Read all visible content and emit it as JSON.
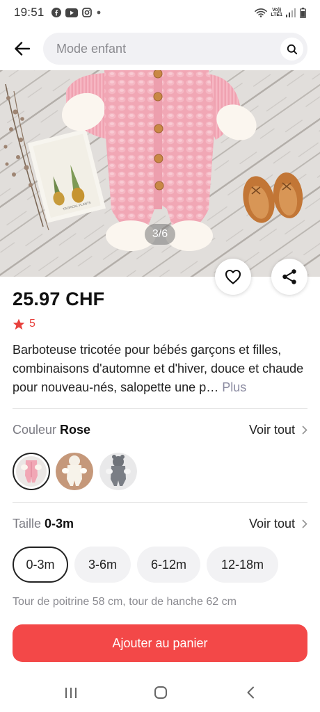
{
  "status_bar": {
    "time": "19:51",
    "network_label_top": "Vo))",
    "network_label_bottom": "LTE1"
  },
  "search": {
    "placeholder": "Mode enfant"
  },
  "product": {
    "image_pager": "3/6",
    "price": "25.97 CHF",
    "rating": "5",
    "description": "Barboteuse tricotée pour bébés garçons et filles, combinaisons d'automne et d'hiver, douce et chaude pour nouveau-nés, salopette une p…",
    "description_more": "Plus"
  },
  "color_section": {
    "label": "Couleur",
    "value": "Rose",
    "see_all": "Voir tout",
    "swatches": [
      {
        "color": "pink",
        "selected": true
      },
      {
        "color": "white",
        "selected": false
      },
      {
        "color": "gray",
        "selected": false
      }
    ]
  },
  "size_section": {
    "label": "Taille",
    "value": "0-3m",
    "see_all": "Voir tout",
    "options": [
      "0-3m",
      "3-6m",
      "6-12m",
      "12-18m"
    ],
    "selected": "0-3m",
    "note": "Tour de poitrine 58 cm, tour de hanche 62 cm"
  },
  "cart_button": "Ajouter au panier",
  "colors": {
    "accent_red": "#f34848",
    "star_red": "#e8413d",
    "romper_pink": "#f1a7b5"
  }
}
